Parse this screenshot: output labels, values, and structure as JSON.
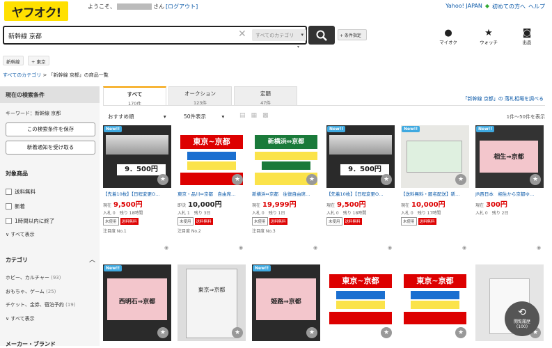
{
  "header": {
    "logo": "ヤフオク!",
    "welcome_prefix": "ようこそ、",
    "welcome_suffix": "さん",
    "logout": "[ログアウト]",
    "yahoo_japan": "Yahoo! JAPAN",
    "beginner": "初めての方へ",
    "help": "ヘルプ"
  },
  "search": {
    "query": "新幹線 京都",
    "category": "すべてのカテゴリ",
    "conditions": "+ 条件指定"
  },
  "header_icons": {
    "mypage": "マイオク",
    "watch": "ウォッチ",
    "sell": "出品"
  },
  "tags": [
    "新幹線",
    "+ 東京"
  ],
  "breadcrumb": {
    "root": "すべてのカテゴリ",
    "sep": ">",
    "current": "「新幹線 京都」の商品一覧"
  },
  "sidebar": {
    "heading": "現在の検索条件",
    "keyword": "キーワード：新幹線 京都",
    "save_button": "この検索条件を保存",
    "notify_button": "新着通知を受け取る",
    "target_heading": "対象商品",
    "checks": [
      "送料無料",
      "新着",
      "1時間以内に終了"
    ],
    "show_all": "∨ すべて表示",
    "category_heading": "カテゴリ",
    "categories": [
      {
        "name": "ホビー、カルチャー",
        "count": "(93)"
      },
      {
        "name": "おもちゃ、ゲーム",
        "count": "(25)"
      },
      {
        "name": "チケット、金券、宿泊予約",
        "count": "(19)"
      }
    ],
    "show_all2": "∨ すべて表示",
    "maker_heading": "メーカー・ブランド"
  },
  "tabs": [
    {
      "label": "すべて",
      "count": "170件"
    },
    {
      "label": "オークション",
      "count": "123件"
    },
    {
      "label": "定額",
      "count": "47件"
    }
  ],
  "market_link": "「新幹線 京都」の 落札相場を調べる",
  "toolbar": {
    "sort": "おすすめ順",
    "per_page": "50件表示",
    "range": "1件～50件を表示"
  },
  "items": [
    {
      "new": "New!!",
      "title": "【先着10枚】【日程変更O…",
      "price_label": "現在",
      "price": "9,500円",
      "bids": "入札 0",
      "remain": "残り 18時間",
      "unused": "未使用",
      "free": "送料無料",
      "attention": "注目度 No.1",
      "img_text": "9．500円"
    },
    {
      "new": "",
      "title": "東京・品川⇔京都　自由席…",
      "price_label": "即決",
      "price": "10,000円",
      "bids": "入札 1",
      "remain": "残り 3日",
      "unused": "未使用",
      "free": "送料無料",
      "attention": "注目度 No.2",
      "img_text": "東京~京都"
    },
    {
      "new": "",
      "title": "新横浜⇔京都　往復自由席…",
      "price_label": "現在",
      "price": "19,999円",
      "bids": "入札 0",
      "remain": "残り 1日",
      "unused": "未使用",
      "free": "送料無料",
      "attention": "注目度 No.3",
      "img_text": "新横浜⇔京都"
    },
    {
      "new": "New!!",
      "title": "【先着10枚】【日程変更O…",
      "price_label": "現在",
      "price": "9,500円",
      "bids": "入札 0",
      "remain": "残り 18時間",
      "unused": "未使用",
      "free": "送料無料",
      "attention": "",
      "img_text": "9．500円"
    },
    {
      "new": "New!!",
      "title": "【送料無料・匿名配送】新…",
      "price_label": "現在",
      "price": "10,000円",
      "bids": "入札 0",
      "remain": "残り 17時間",
      "unused": "未使用",
      "free": "送料無料",
      "attention": "",
      "img_text": ""
    },
    {
      "new": "New!!",
      "title": "JR西日本　相生から京都ゆ…",
      "price_label": "現在",
      "price": "300円",
      "bids": "入札 0",
      "remain": "残り 2日",
      "unused": "",
      "free": "",
      "attention": "",
      "img_text": "相生⇒京都"
    }
  ],
  "row2": [
    {
      "new": "New!!",
      "img_text": "西明石⇒京都"
    },
    {
      "new": "",
      "img_text": "東京⇒京都"
    },
    {
      "new": "New!!",
      "img_text": "姫路⇒京都"
    },
    {
      "new": "",
      "img_text": "東京~京都"
    },
    {
      "new": "",
      "img_text": "東京~京都"
    },
    {
      "new": "",
      "img_text": ""
    }
  ],
  "history": {
    "label": "閲覧履歴",
    "count": "(100)"
  }
}
